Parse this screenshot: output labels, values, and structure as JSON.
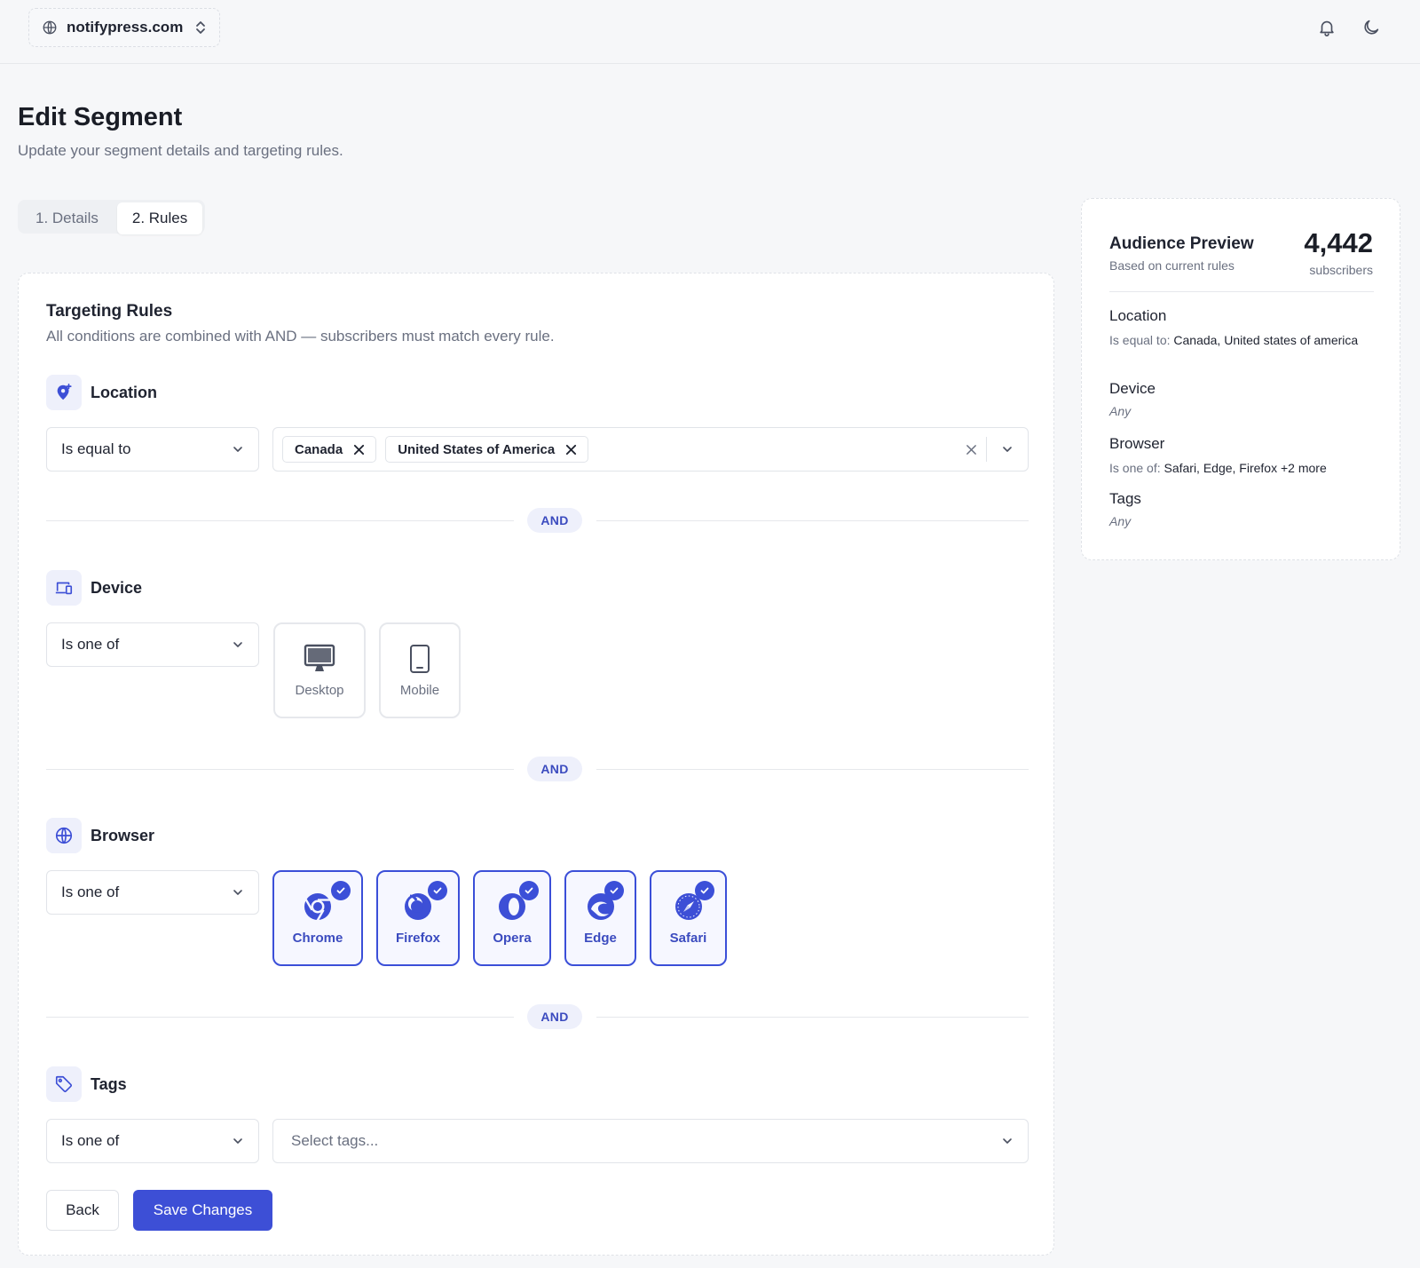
{
  "topbar": {
    "site_name": "notifypress.com",
    "icons": [
      "globe-icon",
      "chevron-up-down-icon",
      "bell-icon",
      "moon-icon"
    ]
  },
  "page": {
    "title": "Edit Segment",
    "subtitle": "Update your segment details and targeting rules."
  },
  "tabs": [
    {
      "label": "1. Details",
      "active": false
    },
    {
      "label": "2. Rules",
      "active": true
    }
  ],
  "targeting": {
    "title": "Targeting Rules",
    "subtitle": "All conditions are combined with AND — subscribers must match every rule.",
    "and_label": "AND",
    "location": {
      "label": "Location",
      "operator": "Is equal to",
      "values": [
        "Canada",
        "United States of America"
      ]
    },
    "device": {
      "label": "Device",
      "operator": "Is one of",
      "options": [
        {
          "label": "Desktop",
          "selected": false,
          "icon": "desktop-icon"
        },
        {
          "label": "Mobile",
          "selected": false,
          "icon": "mobile-icon"
        }
      ]
    },
    "browser": {
      "label": "Browser",
      "operator": "Is one of",
      "options": [
        {
          "label": "Chrome",
          "selected": true,
          "icon": "chrome-icon"
        },
        {
          "label": "Firefox",
          "selected": true,
          "icon": "firefox-icon"
        },
        {
          "label": "Opera",
          "selected": true,
          "icon": "opera-icon"
        },
        {
          "label": "Edge",
          "selected": true,
          "icon": "edge-icon"
        },
        {
          "label": "Safari",
          "selected": true,
          "icon": "safari-icon"
        }
      ]
    },
    "tags": {
      "label": "Tags",
      "operator": "Is one of",
      "placeholder": "Select tags..."
    }
  },
  "actions": {
    "back": "Back",
    "save": "Save Changes"
  },
  "preview": {
    "title": "Audience Preview",
    "subtitle": "Based on current rules",
    "count": "4,442",
    "count_label": "subscribers",
    "location_label": "Location",
    "location_prefix": "Is equal to:",
    "location_value": "Canada, United states of america",
    "device_label": "Device",
    "device_value": "Any",
    "browser_label": "Browser",
    "browser_prefix": "Is one of:",
    "browser_value": "Safari, Edge, Firefox +2 more",
    "tags_label": "Tags",
    "tags_value": "Any"
  },
  "colors": {
    "accent": "#3d4fd6",
    "accent_soft": "#eef0fb",
    "text": "#1f2330",
    "muted": "#6a7080"
  }
}
